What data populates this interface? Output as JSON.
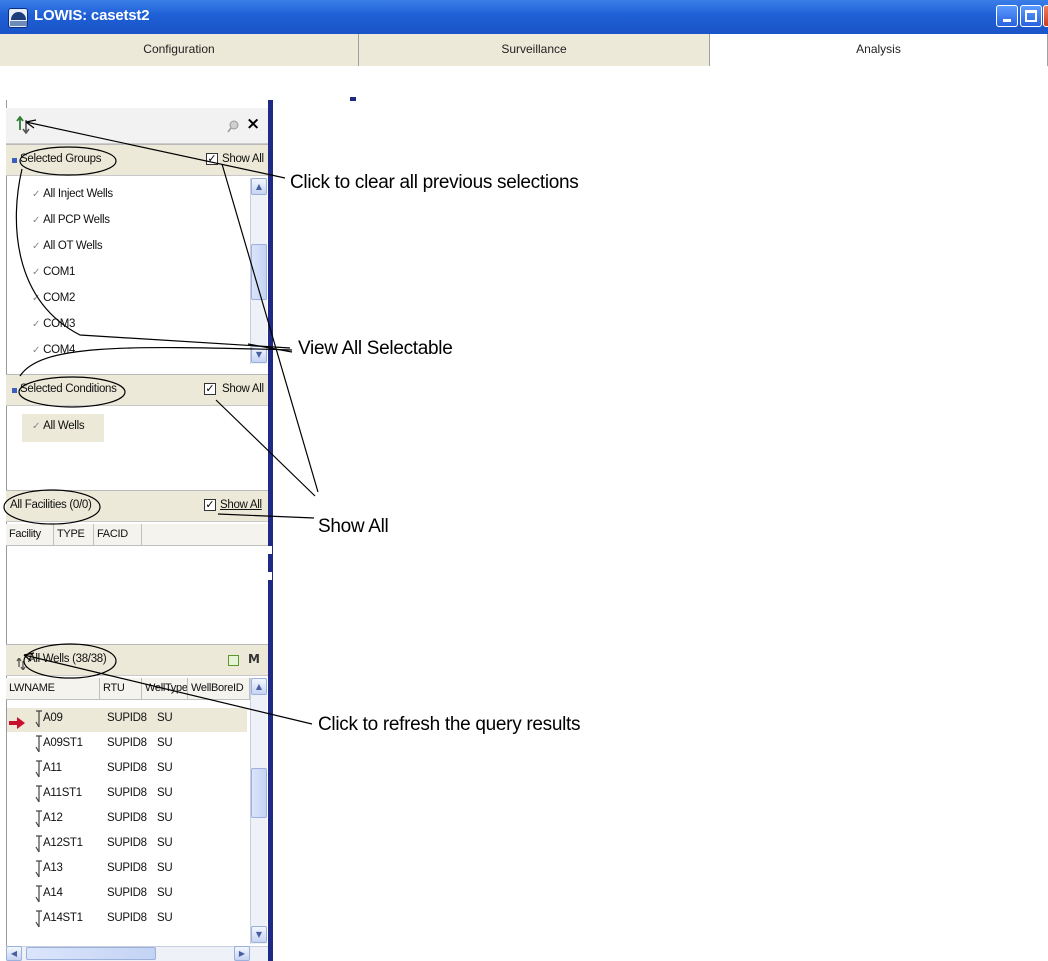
{
  "window": {
    "title": "LOWIS: casetst2",
    "icon": "lowis-app-icon",
    "controls": [
      "minimize-icon",
      "maximize-icon",
      "close-icon"
    ]
  },
  "tabs": [
    {
      "label": "Configuration",
      "active": false
    },
    {
      "label": "Surveillance",
      "active": false
    },
    {
      "label": "Analysis",
      "active": true
    }
  ],
  "toolbar": {
    "icons": [
      "clear-selections-icon",
      "pin-icon",
      "close-icon"
    ],
    "close_glyph": "×"
  },
  "selected_groups": {
    "label": "Selected Groups",
    "show_all_label": "Show All",
    "show_all_checked": true,
    "items": [
      "All Inject Wells",
      "All PCP Wells",
      "All OT Wells",
      "COM1",
      "COM2",
      "COM3",
      "COM4"
    ]
  },
  "selected_conditions": {
    "label": "Selected Conditions",
    "show_all_label": "Show All",
    "show_all_checked": true,
    "items": [
      "All Wells"
    ]
  },
  "facilities": {
    "label": "All Facilities (0/0)",
    "show_all_label": "Show All",
    "show_all_checked": true,
    "columns": [
      "Facility",
      "TYPE",
      "FACID"
    ]
  },
  "wells": {
    "label": "All Wells (38/38)",
    "columns": [
      "LWNAME",
      "RTU",
      "WellType",
      "WellBoreID"
    ],
    "rows": [
      {
        "name": "A09",
        "rtu": "SUPID8",
        "type": "SU",
        "current": true
      },
      {
        "name": "A09ST1",
        "rtu": "SUPID8",
        "type": "SU"
      },
      {
        "name": "A11",
        "rtu": "SUPID8",
        "type": "SU"
      },
      {
        "name": "A11ST1",
        "rtu": "SUPID8",
        "type": "SU"
      },
      {
        "name": "A12",
        "rtu": "SUPID8",
        "type": "SU"
      },
      {
        "name": "A12ST1",
        "rtu": "SUPID8",
        "type": "SU"
      },
      {
        "name": "A13",
        "rtu": "SUPID8",
        "type": "SU"
      },
      {
        "name": "A14",
        "rtu": "SUPID8",
        "type": "SU"
      },
      {
        "name": "A14ST1",
        "rtu": "SUPID8",
        "type": "SU"
      }
    ]
  },
  "annotations": {
    "clear": "Click to clear all previous selections",
    "view_all": "View All Selectable",
    "show_all": "Show All",
    "refresh": "Click to refresh the query results"
  },
  "colors": {
    "titlebar": "#1f5fd6",
    "divider": "#1f2a86",
    "panel_header": "#ece9d8",
    "row_arrow": "#c8102e"
  }
}
